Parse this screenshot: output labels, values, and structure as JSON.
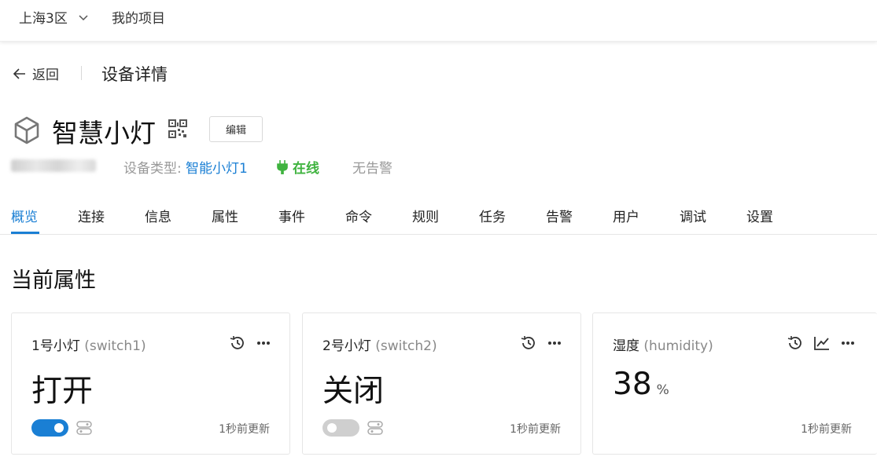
{
  "header": {
    "region": "上海3区",
    "project": "我的项目"
  },
  "breadcrumb": {
    "back_label": "返回",
    "title": "设备详情"
  },
  "device": {
    "name": "智慧小灯",
    "edit_label": "编辑",
    "type_label": "设备类型:",
    "type_value": "智能小灯1",
    "status": "在线",
    "alarm": "无告警"
  },
  "tabs": [
    "概览",
    "连接",
    "信息",
    "属性",
    "事件",
    "命令",
    "规则",
    "任务",
    "告警",
    "用户",
    "调试",
    "设置"
  ],
  "section_title": "当前属性",
  "cards": [
    {
      "title": "1号小灯",
      "key": "(switch1)",
      "value": "打开",
      "unit": "",
      "toggle": "on",
      "updated": "1秒前更新"
    },
    {
      "title": "2号小灯",
      "key": "(switch2)",
      "value": "关闭",
      "unit": "",
      "toggle": "off",
      "updated": "1秒前更新"
    },
    {
      "title": "湿度",
      "key": "(humidity)",
      "value": "38",
      "unit": "%",
      "toggle": null,
      "updated": "1秒前更新"
    }
  ],
  "colors": {
    "accent": "#1a7fd4",
    "online": "#3fb33f"
  }
}
